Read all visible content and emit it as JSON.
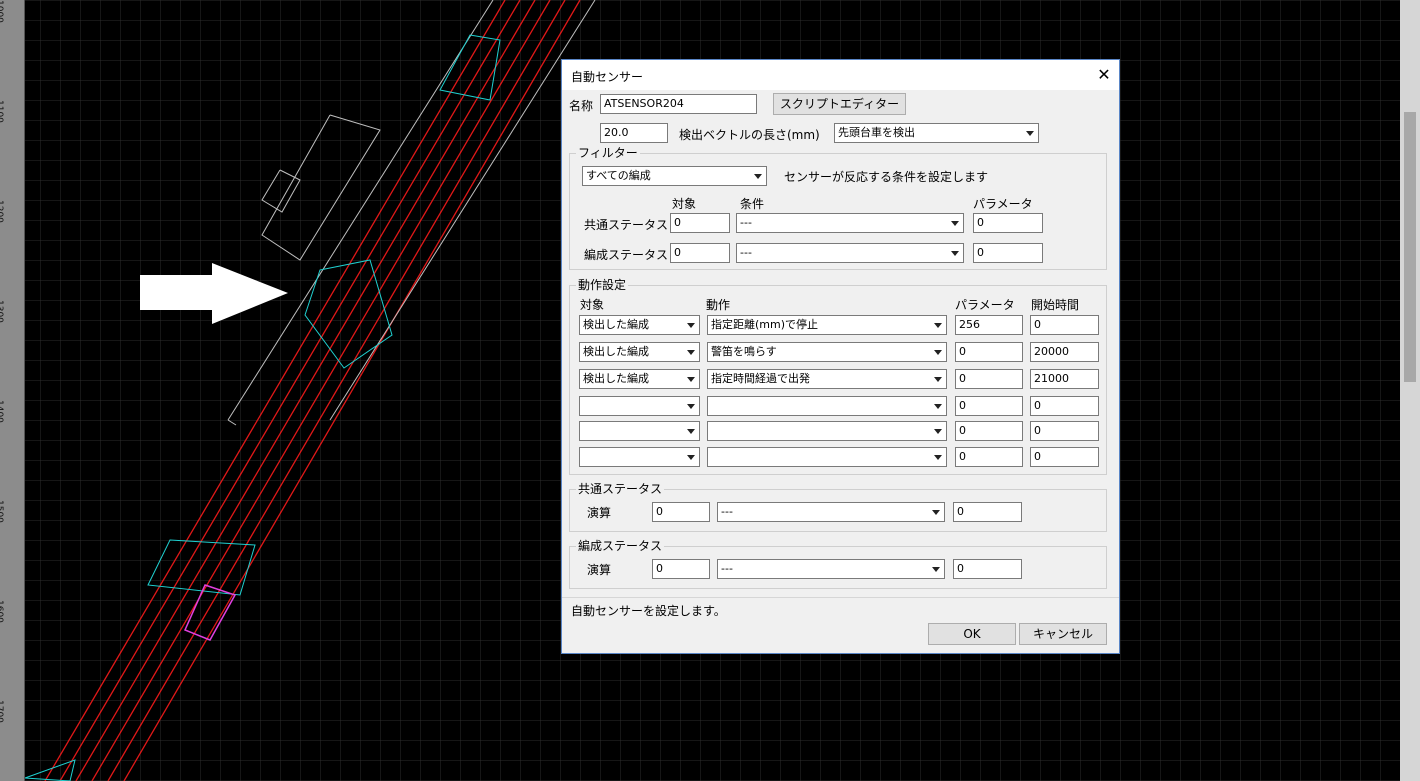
{
  "ruler": {
    "ticks": [
      "1000",
      "1100",
      "1200",
      "1300",
      "1400",
      "1500",
      "1600",
      "1700"
    ]
  },
  "dialog": {
    "title": "自動センサー",
    "close_glyph": "✕",
    "name_label": "名称",
    "name_value": "ATSENSOR204",
    "script_editor_button": "スクリプトエディター",
    "vector_length_value": "20.0",
    "vector_length_label": "検出ベクトルの長さ(mm)",
    "detect_mode": "先頭台車を検出",
    "filter": {
      "title": "フィルター",
      "train_select": "すべての編成",
      "description": "センサーが反応する条件を設定します",
      "col_target": "対象",
      "col_condition": "条件",
      "col_parameter": "パラメータ",
      "rows": [
        {
          "label": "共通ステータス",
          "target": "0",
          "condition": "---",
          "parameter": "0"
        },
        {
          "label": "編成ステータス",
          "target": "0",
          "condition": "---",
          "parameter": "0"
        }
      ]
    },
    "action": {
      "title": "動作設定",
      "col_target": "対象",
      "col_action": "動作",
      "col_parameter": "パラメータ",
      "col_start": "開始時間",
      "rows": [
        {
          "target": "検出した編成",
          "action": "指定距離(mm)で停止",
          "parameter": "256",
          "start": "0"
        },
        {
          "target": "検出した編成",
          "action": "警笛を鳴らす",
          "parameter": "0",
          "start": "20000"
        },
        {
          "target": "検出した編成",
          "action": "指定時間経過で出発",
          "parameter": "0",
          "start": "21000"
        },
        {
          "target": "",
          "action": "",
          "parameter": "0",
          "start": "0"
        },
        {
          "target": "",
          "action": "",
          "parameter": "0",
          "start": "0"
        },
        {
          "target": "",
          "action": "",
          "parameter": "0",
          "start": "0"
        }
      ]
    },
    "common_status": {
      "title": "共通ステータス",
      "op_label": "演算",
      "value": "0",
      "op": "---",
      "result": "0"
    },
    "train_status": {
      "title": "編成ステータス",
      "op_label": "演算",
      "value": "0",
      "op": "---",
      "result": "0"
    },
    "status_text": "自動センサーを設定します。",
    "ok_button": "OK",
    "cancel_button": "キャンセル"
  }
}
